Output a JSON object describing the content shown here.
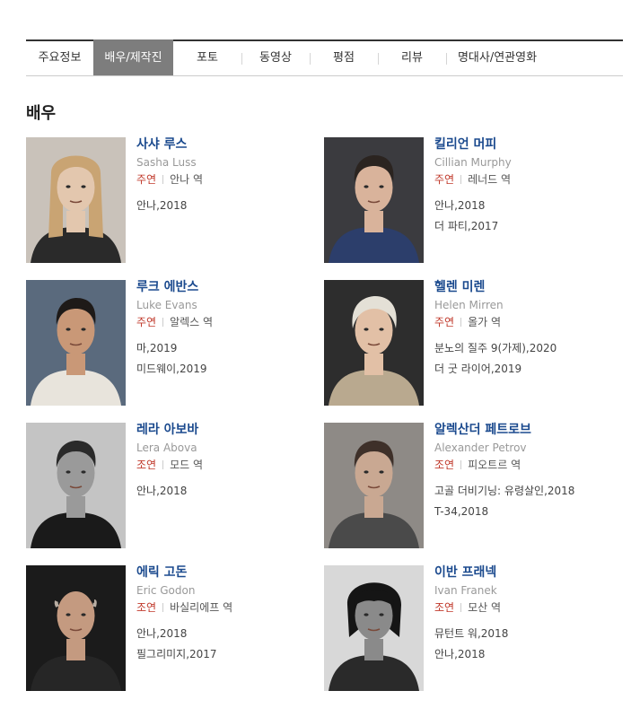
{
  "tabs": [
    {
      "label": "주요정보",
      "active": false
    },
    {
      "label": "배우/제작진",
      "active": true
    },
    {
      "label": "포토",
      "active": false
    },
    {
      "label": "동영상",
      "active": false
    },
    {
      "label": "평점",
      "active": false
    },
    {
      "label": "리뷰",
      "active": false
    },
    {
      "label": "명대사/연관영화",
      "active": false
    }
  ],
  "section_title": "배우",
  "cast": [
    {
      "kname": "사샤 루스",
      "ename": "Sasha Luss",
      "role_type": "주연",
      "role": "안나 역",
      "films": [
        "안나,2018"
      ],
      "photo": {
        "bg": "#c9c2ba",
        "skin": "#e3c7ae",
        "hair": "#c9a473",
        "cloth": "#2a2a2a",
        "style": "long-blonde"
      }
    },
    {
      "kname": "킬리언 머피",
      "ename": "Cillian Murphy",
      "role_type": "주연",
      "role": "레너드 역",
      "films": [
        "안나,2018",
        "더 파티,2017"
      ],
      "photo": {
        "bg": "#3b3b3f",
        "skin": "#d9b39b",
        "hair": "#2b2420",
        "cloth": "#2c3e6b",
        "style": "short-dark"
      }
    },
    {
      "kname": "루크 에반스",
      "ename": "Luke Evans",
      "role_type": "주연",
      "role": "알렉스 역",
      "films": [
        "마,2019",
        "미드웨이,2019"
      ],
      "photo": {
        "bg": "#5a6a7d",
        "skin": "#c99877",
        "hair": "#1e1a18",
        "cloth": "#e8e4dc",
        "style": "short-dark"
      }
    },
    {
      "kname": "헬렌 미렌",
      "ename": "Helen Mirren",
      "role_type": "주연",
      "role": "올가 역",
      "films": [
        "분노의 질주 9(가제),2020",
        "더 굿 라이어,2019"
      ],
      "photo": {
        "bg": "#2d2d2d",
        "skin": "#e2c0a6",
        "hair": "#e4e0d6",
        "cloth": "#b9a98f",
        "style": "short-white"
      }
    },
    {
      "kname": "레라 아보바",
      "ename": "Lera Abova",
      "role_type": "조연",
      "role": "모드 역",
      "films": [
        "안나,2018"
      ],
      "photo": {
        "bg": "#c4c4c4",
        "skin": "#9a9a9a",
        "hair": "#2a2a2a",
        "cloth": "#1a1a1a",
        "style": "bw-short"
      }
    },
    {
      "kname": "알렉산더 페트로브",
      "ename": "Alexander Petrov",
      "role_type": "조연",
      "role": "피오트르 역",
      "films": [
        "고골 더비기닝: 유령살인,2018",
        "T-34,2018"
      ],
      "photo": {
        "bg": "#8e8a86",
        "skin": "#c9a892",
        "hair": "#3e3029",
        "cloth": "#4a4a4a",
        "style": "short-dark"
      }
    },
    {
      "kname": "에릭 고돈",
      "ename": "Eric Godon",
      "role_type": "조연",
      "role": "바실리에프 역",
      "films": [
        "안나,2018",
        "필그리미지,2017"
      ],
      "photo": {
        "bg": "#1b1b1b",
        "skin": "#c49a80",
        "hair": "#b9aea3",
        "cloth": "#262626",
        "style": "bald"
      }
    },
    {
      "kname": "이반 프래넥",
      "ename": "Ivan Franek",
      "role_type": "조연",
      "role": "모산 역",
      "films": [
        "뮤턴트 워,2018",
        "안나,2018"
      ],
      "photo": {
        "bg": "#d8d8d8",
        "skin": "#8a8a8a",
        "hair": "#151515",
        "cloth": "#2a2a2a",
        "style": "bw-shaggy"
      }
    }
  ]
}
